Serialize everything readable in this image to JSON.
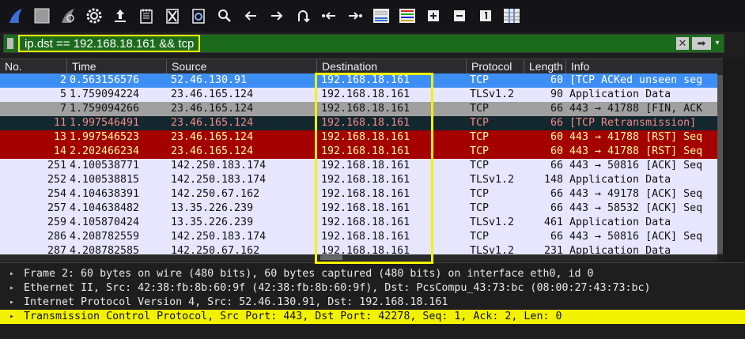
{
  "toolbar": {
    "icons": [
      "shark-fin-start-icon",
      "stop-square-icon",
      "restart-fin-icon",
      "gear-options-icon",
      "open-file-icon",
      "save-file-icon",
      "close-file-icon",
      "reload-icon",
      "search-icon",
      "arrow-left-icon",
      "arrow-right-icon",
      "go-to-packet-icon",
      "first-packet-icon",
      "last-packet-icon",
      "autoscroll-icon",
      "colorize-icon",
      "zoom-in-icon",
      "zoom-out-icon",
      "normal-size-icon",
      "resize-columns-icon"
    ]
  },
  "filter": {
    "text": "ip.dst == 192.168.18.161 && tcp",
    "clear_symbol": "✕",
    "apply_symbol": "➡",
    "dropdown_symbol": "▾"
  },
  "columns": [
    "No.",
    "Time",
    "Source",
    "Destination",
    "Protocol",
    "Length",
    "Info"
  ],
  "packets": [
    {
      "no": "2",
      "time": "0.563156576",
      "source": "52.46.130.91",
      "destination": "192.168.18.161",
      "protocol": "TCP",
      "length": "60",
      "info": "[TCP ACKed unseen seg",
      "bg": "#3d8ff5",
      "fg": "#ffffff"
    },
    {
      "no": "5",
      "time": "1.759094224",
      "source": "23.46.165.124",
      "destination": "192.168.18.161",
      "protocol": "TLSv1.2",
      "length": "90",
      "info": "Application Data",
      "bg": "#e7e6ff",
      "fg": "#121212"
    },
    {
      "no": "7",
      "time": "1.759094266",
      "source": "23.46.165.124",
      "destination": "192.168.18.161",
      "protocol": "TCP",
      "length": "66",
      "info": "443 → 41788 [FIN, ACK",
      "bg": "#a0a0a0",
      "fg": "#121212"
    },
    {
      "no": "11",
      "time": "1.997546491",
      "source": "23.46.165.124",
      "destination": "192.168.18.161",
      "protocol": "TCP",
      "length": "66",
      "info": "[TCP Retransmission]",
      "bg": "#12272e",
      "fg": "#f78787"
    },
    {
      "no": "13",
      "time": "1.997546523",
      "source": "23.46.165.124",
      "destination": "192.168.18.161",
      "protocol": "TCP",
      "length": "60",
      "info": "443 → 41788 [RST] Seq",
      "bg": "#a40000",
      "fg": "#fffc9c"
    },
    {
      "no": "14",
      "time": "2.202466234",
      "source": "23.46.165.124",
      "destination": "192.168.18.161",
      "protocol": "TCP",
      "length": "60",
      "info": "443 → 41788 [RST] Seq",
      "bg": "#a40000",
      "fg": "#fffc9c"
    },
    {
      "no": "251",
      "time": "4.100538771",
      "source": "142.250.183.174",
      "destination": "192.168.18.161",
      "protocol": "TCP",
      "length": "66",
      "info": "443 → 50816 [ACK] Seq",
      "bg": "#e7e6ff",
      "fg": "#121212"
    },
    {
      "no": "252",
      "time": "4.100538815",
      "source": "142.250.183.174",
      "destination": "192.168.18.161",
      "protocol": "TLSv1.2",
      "length": "148",
      "info": "Application Data",
      "bg": "#e7e6ff",
      "fg": "#121212"
    },
    {
      "no": "254",
      "time": "4.104638391",
      "source": "142.250.67.162",
      "destination": "192.168.18.161",
      "protocol": "TCP",
      "length": "66",
      "info": "443 → 49178 [ACK] Seq",
      "bg": "#e7e6ff",
      "fg": "#121212"
    },
    {
      "no": "257",
      "time": "4.104638482",
      "source": "13.35.226.239",
      "destination": "192.168.18.161",
      "protocol": "TCP",
      "length": "66",
      "info": "443 → 58532 [ACK] Seq",
      "bg": "#e7e6ff",
      "fg": "#121212"
    },
    {
      "no": "259",
      "time": "4.105870424",
      "source": "13.35.226.239",
      "destination": "192.168.18.161",
      "protocol": "TLSv1.2",
      "length": "461",
      "info": "Application Data",
      "bg": "#e7e6ff",
      "fg": "#121212"
    },
    {
      "no": "286",
      "time": "4.208782559",
      "source": "142.250.183.174",
      "destination": "192.168.18.161",
      "protocol": "TCP",
      "length": "66",
      "info": "443 → 50816 [ACK] Seq",
      "bg": "#e7e6ff",
      "fg": "#121212"
    },
    {
      "no": "287",
      "time": "4.208782585",
      "source": "142.250.67.162",
      "destination": "192.168.18.161",
      "protocol": "TLSv1.2",
      "length": "231",
      "info": "Application Data",
      "bg": "#e7e6ff",
      "fg": "#121212"
    }
  ],
  "details": [
    {
      "text": "Frame 2: 60 bytes on wire (480 bits), 60 bytes captured (480 bits) on interface eth0, id 0",
      "highlight": false
    },
    {
      "text": "Ethernet II, Src: 42:38:fb:8b:60:9f (42:38:fb:8b:60:9f), Dst: PcsCompu_43:73:bc (08:00:27:43:73:bc)",
      "highlight": false
    },
    {
      "text": "Internet Protocol Version 4, Src: 52.46.130.91, Dst: 192.168.18.161",
      "highlight": false
    },
    {
      "text": "Transmission Control Protocol, Src Port: 443, Dst Port: 42278, Seq: 1, Ack: 2, Len: 0",
      "highlight": true
    }
  ],
  "detail_arrow": "▸",
  "colors": {
    "highlight_yellow": "#f2f200",
    "filter_green": "#1c6b1c",
    "selected_blue": "#3d8ff5",
    "rst_red": "#a40000"
  }
}
